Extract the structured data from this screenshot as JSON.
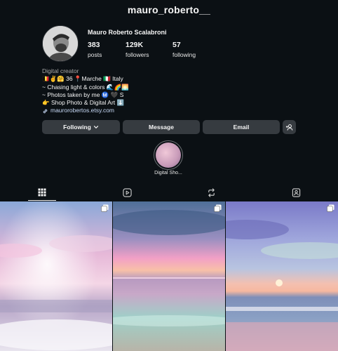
{
  "profile": {
    "username": "mauro_roberto__",
    "full_name": "Mauro Roberto Scalabroni",
    "stats": {
      "posts": {
        "value": "383",
        "label": "posts"
      },
      "followers": {
        "value": "129K",
        "label": "followers"
      },
      "following": {
        "value": "57",
        "label": "following"
      }
    },
    "bio": {
      "category": "Digital creator",
      "lines": [
        "🇧🇪✌️🤗 36 📍Marche 🇮🇹 Italy",
        "~ Chasing light & colors 🌊🌈🌅",
        "~ Photos taken by me Ⓜ️ 🖤 S",
        "👉 Shop Photo & Digital Art ⬇️"
      ],
      "link": "maurorobertos.etsy.com"
    }
  },
  "actions": {
    "following": "Following",
    "message": "Message",
    "email": "Email"
  },
  "highlights": [
    {
      "label": "Digital Sho..."
    }
  ],
  "tabs": [
    "posts-grid-icon",
    "reels-icon",
    "reposts-icon",
    "tagged-icon"
  ],
  "posts": [
    {
      "description": "pink sunset sky with sun rays over sea waves",
      "type": "carousel"
    },
    {
      "description": "pastel sunset over calm sea",
      "type": "carousel"
    },
    {
      "description": "sunset on the beach with purple clouds",
      "type": "carousel"
    }
  ],
  "colors": {
    "background": "#0b1014",
    "button": "#363b40",
    "link": "#c6d8f5"
  }
}
